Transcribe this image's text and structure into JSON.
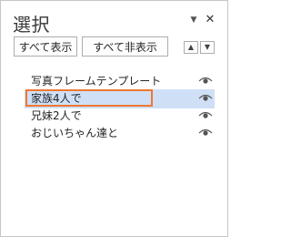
{
  "pane": {
    "title": "選択",
    "options_icon": "chevron-down-icon",
    "close_icon": "close-icon"
  },
  "buttons": {
    "show_all": "すべて表示",
    "hide_all": "すべて非表示",
    "move_up_icon": "triangle-up-icon",
    "move_down_icon": "triangle-down-icon"
  },
  "objects": [
    {
      "label": "写真フレームテンプレート",
      "visible": true,
      "selected": false
    },
    {
      "label": "家族4人で",
      "visible": true,
      "selected": true
    },
    {
      "label": "兄妹2人で",
      "visible": true,
      "selected": false
    },
    {
      "label": "おじいちゃん達と",
      "visible": true,
      "selected": false
    }
  ],
  "colors": {
    "selection_bg": "#cfe0f6",
    "highlight_border": "#ef7733"
  }
}
